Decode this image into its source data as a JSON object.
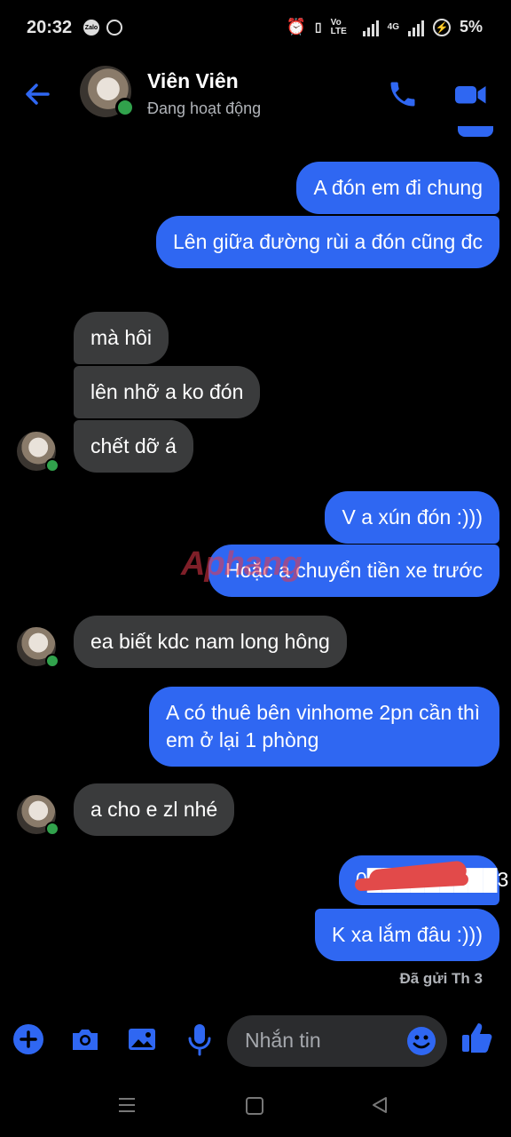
{
  "status_bar": {
    "time": "20:32",
    "apps": [
      "Zalo",
      "messenger-icon"
    ],
    "network_labels": [
      "Vo LTE",
      "4G"
    ],
    "battery": "5%"
  },
  "header": {
    "contact_name": "Viên Viên",
    "contact_status": "Đang hoạt động",
    "accent_color": "#2f67f2"
  },
  "messages": [
    {
      "from": "me",
      "text": "A đón em đi chung"
    },
    {
      "from": "me",
      "text": "Lên giữa đường rùi a đón cũng đc"
    },
    {
      "from": "them",
      "text": "mà hôi"
    },
    {
      "from": "them",
      "text": "lên nhỡ a ko đón"
    },
    {
      "from": "them",
      "text": "chết dỡ á"
    },
    {
      "from": "me",
      "text": "V a xún đón :)))"
    },
    {
      "from": "me",
      "text": "Hoặc a chuyển tiền xe trước"
    },
    {
      "from": "them",
      "text": "ea biết kdc nam long hông"
    },
    {
      "from": "me",
      "text": "A có thuê bên vinhome 2pn cần thì em ở lại 1 phòng"
    },
    {
      "from": "them",
      "text": "a cho e zl nhé"
    },
    {
      "from": "me",
      "text": "0█████████3"
    },
    {
      "from": "me",
      "text": "K xa lắm đâu :)))"
    }
  ],
  "seen_status": "Đã gửi Th 3",
  "composer": {
    "placeholder": "Nhắn tin"
  },
  "watermark": "Aphang"
}
